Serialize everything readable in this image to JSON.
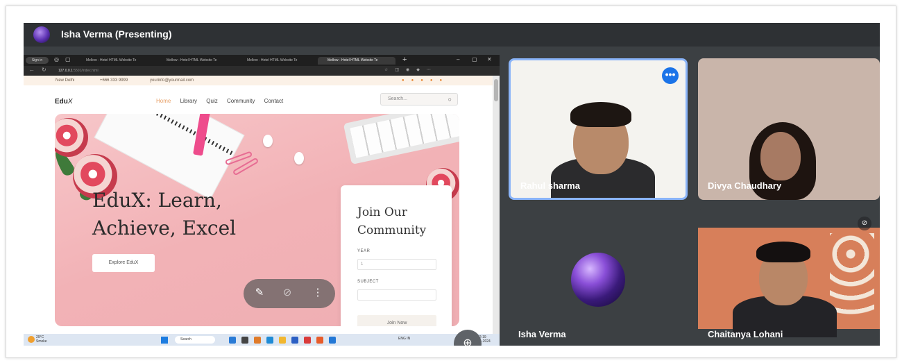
{
  "meeting": {
    "presenter_banner": "Isha Verma (Presenting)"
  },
  "browser": {
    "sign_in": "Sign in",
    "tabs": [
      "Mellow - Hotel HTML Website Te",
      "Mellow - Hotel HTML Website Te",
      "Mellow - Hotel HTML Website Te",
      "Mellow - Hotel HTML Website Te"
    ],
    "url_host": "127.0.0.1",
    "url_path": ":5501/index.html"
  },
  "website": {
    "info_location": "New Delhi",
    "info_phone": "+666 333 9999",
    "info_email": "yourinfo@yourmail.com",
    "logo_text": "Edu",
    "logo_suffix": "X",
    "nav": [
      "Home",
      "Library",
      "Quiz",
      "Community",
      "Contact"
    ],
    "search_placeholder": "Search...",
    "hero_title_line1": "EduX: Learn,",
    "hero_title_line2": "Achieve, Excel",
    "explore_button": "Explore EduX",
    "join_title": "Join Our Community",
    "year_label": "YEAR",
    "year_value": "1",
    "subject_label": "SUBJECT",
    "subject_value": "",
    "join_button": "Join Now"
  },
  "taskbar": {
    "weather_temp": "29°C",
    "weather_desc": "Smoke",
    "search_label": "Search",
    "tray_lang": "ENG IN",
    "clock_time": "12:19",
    "clock_date": "11-11-2024"
  },
  "participants": [
    {
      "name": "Rahul sharma"
    },
    {
      "name": "Divya Chaudhary"
    },
    {
      "name": "Isha Verma"
    },
    {
      "name": "Chaitanya Lohani"
    }
  ],
  "colors": {
    "meet_background": "#3c4043",
    "active_speaker_border": "#8ab4f8",
    "more_button": "#1a73e8",
    "hero_pink": "#f2b2b6",
    "nav_active": "#e8a26a"
  },
  "icons": {
    "pin": "pin-off-icon",
    "mute": "mic-off-icon",
    "more": "more-vert-icon",
    "zoom": "zoom-in-icon"
  }
}
